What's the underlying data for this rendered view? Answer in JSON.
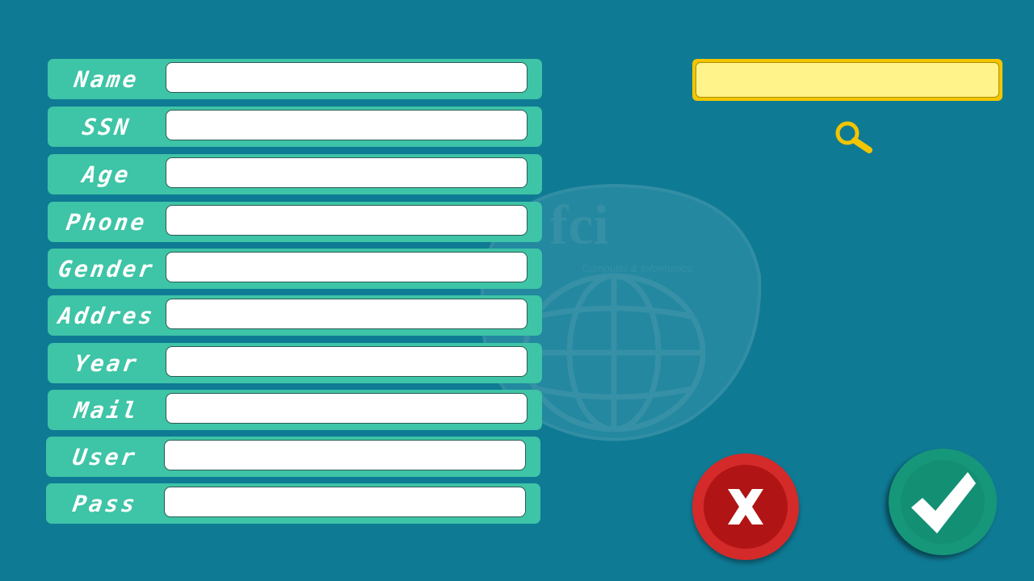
{
  "form": {
    "fields": [
      {
        "label": "Name",
        "value": ""
      },
      {
        "label": "SSN",
        "value": ""
      },
      {
        "label": "Age",
        "value": ""
      },
      {
        "label": "Phone",
        "value": ""
      },
      {
        "label": "Gender",
        "value": ""
      },
      {
        "label": "Addres",
        "value": ""
      },
      {
        "label": "Year",
        "value": ""
      },
      {
        "label": "Mail",
        "value": ""
      },
      {
        "label": "User",
        "value": ""
      },
      {
        "label": "Pass",
        "value": ""
      }
    ]
  },
  "search": {
    "value": "",
    "icon": "search-icon"
  },
  "actions": {
    "cancel_icon": "close-icon",
    "confirm_icon": "check-icon"
  },
  "watermark": {
    "text": "fci",
    "subtitle": "Computer & Informatics"
  },
  "colors": {
    "background": "#0f7a94",
    "row": "#3ec4a6",
    "search_border": "#f2c500",
    "search_fill": "#fff38a",
    "cancel": "#d42a2a",
    "confirm": "#16977a"
  }
}
